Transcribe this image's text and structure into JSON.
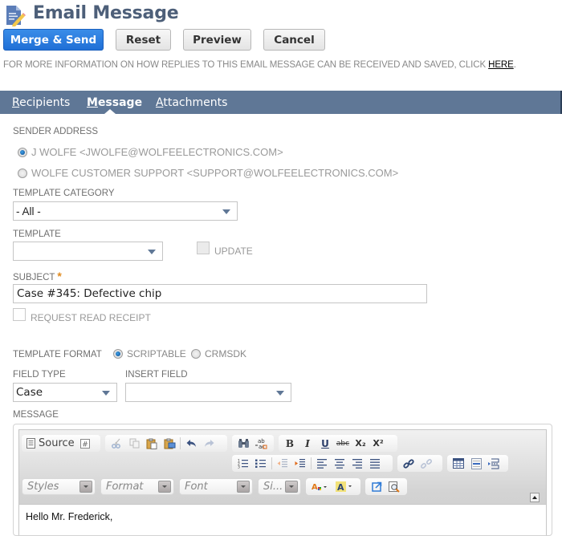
{
  "header": {
    "title": "Email Message",
    "icon": "document-edit-icon"
  },
  "actions": {
    "merge_send": "Merge & Send",
    "reset": "Reset",
    "preview": "Preview",
    "cancel": "Cancel"
  },
  "info": {
    "text": "FOR MORE INFORMATION ON HOW REPLIES TO THIS EMAIL MESSAGE CAN BE RECEIVED AND SAVED, CLICK ",
    "link": "HERE",
    "suffix": "."
  },
  "tabs": [
    {
      "label_first": "R",
      "label_rest": "ecipients",
      "active": false
    },
    {
      "label_first": "M",
      "label_rest": "essage",
      "active": true
    },
    {
      "label_first": "A",
      "label_rest": "ttachments",
      "active": false
    }
  ],
  "form": {
    "sender_address": {
      "label": "SENDER ADDRESS",
      "options": [
        {
          "label": "J WOLFE <JWOLFE@WOLFEELECTRONICS.COM>",
          "selected": true
        },
        {
          "label": "WOLFE CUSTOMER SUPPORT <SUPPORT@WOLFEELECTRONICS.COM>",
          "selected": false
        }
      ]
    },
    "template_category": {
      "label": "TEMPLATE CATEGORY",
      "value": "- All -"
    },
    "template": {
      "label": "TEMPLATE",
      "value": ""
    },
    "update": {
      "label": "UPDATE",
      "checked": false,
      "disabled": true
    },
    "subject": {
      "label": "SUBJECT",
      "required_mark": "*",
      "value": "Case #345: Defective chip"
    },
    "read_receipt": {
      "label": "REQUEST READ RECEIPT",
      "checked": false
    },
    "template_format": {
      "label": "TEMPLATE FORMAT",
      "options": [
        {
          "label": "SCRIPTABLE",
          "selected": true
        },
        {
          "label": "CRMSDK",
          "selected": false
        }
      ]
    },
    "field_type": {
      "label": "FIELD TYPE",
      "value": "Case"
    },
    "insert_field": {
      "label": "INSERT FIELD",
      "value": ""
    },
    "message": {
      "label": "MESSAGE"
    }
  },
  "editor": {
    "source_label": "Source",
    "combos": {
      "styles": "Styles",
      "format": "Format",
      "font": "Font",
      "size": "Si..."
    },
    "toolbar_glyphs": {
      "bold": "B",
      "italic": "I",
      "underline": "U",
      "strike": "abc",
      "subscript": "X₂",
      "superscript": "X²"
    },
    "content": "Hello Mr. Frederick,"
  },
  "colors": {
    "primary": "#1f6fd6",
    "tabbar": "#5f7796",
    "title": "#4d5f79",
    "required": "#e08a1e"
  }
}
